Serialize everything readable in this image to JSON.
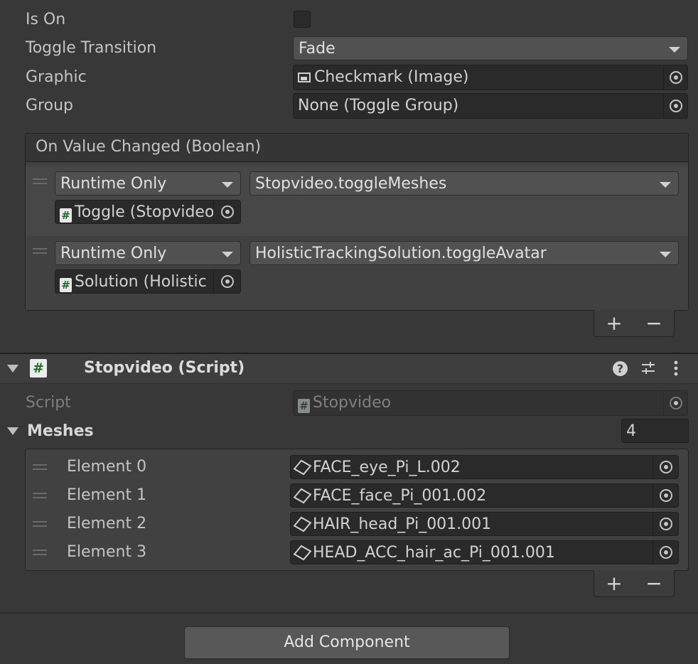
{
  "toggle": {
    "is_on_label": "Is On",
    "is_on_checked": false,
    "transition_label": "Toggle Transition",
    "transition_value": "Fade",
    "graphic_label": "Graphic",
    "graphic_value": "Checkmark (Image)",
    "group_label": "Group",
    "group_value": "None (Toggle Group)"
  },
  "event": {
    "title": "On Value Changed (Boolean)",
    "listeners": [
      {
        "mode": "Runtime Only",
        "function": "Stopvideo.toggleMeshes",
        "target": "Toggle (Stopvideo"
      },
      {
        "mode": "Runtime Only",
        "function": "HolisticTrackingSolution.toggleAvatar",
        "target": "Solution (Holistic"
      }
    ],
    "add": "+",
    "remove": "−"
  },
  "component": {
    "title": "Stopvideo (Script)",
    "icons": [
      "help-icon",
      "presets-icon",
      "more-menu-icon"
    ],
    "script_label": "Script",
    "script_value": "Stopvideo",
    "meshes_label": "Meshes",
    "meshes_count": "4",
    "elements": [
      {
        "label": "Element 0",
        "value": "FACE_eye_Pi_L.002"
      },
      {
        "label": "Element 1",
        "value": "FACE_face_Pi_001.002"
      },
      {
        "label": "Element 2",
        "value": "HAIR_head_Pi_001.001"
      },
      {
        "label": "Element 3",
        "value": "HEAD_ACC_hair_ac_Pi_001.001"
      }
    ],
    "add": "+",
    "remove": "−"
  },
  "add_component_label": "Add Component",
  "colors": {
    "background": "#383838",
    "field": "#2a2a2a",
    "dropdown": "#515151",
    "text": "#c4c4c4"
  }
}
